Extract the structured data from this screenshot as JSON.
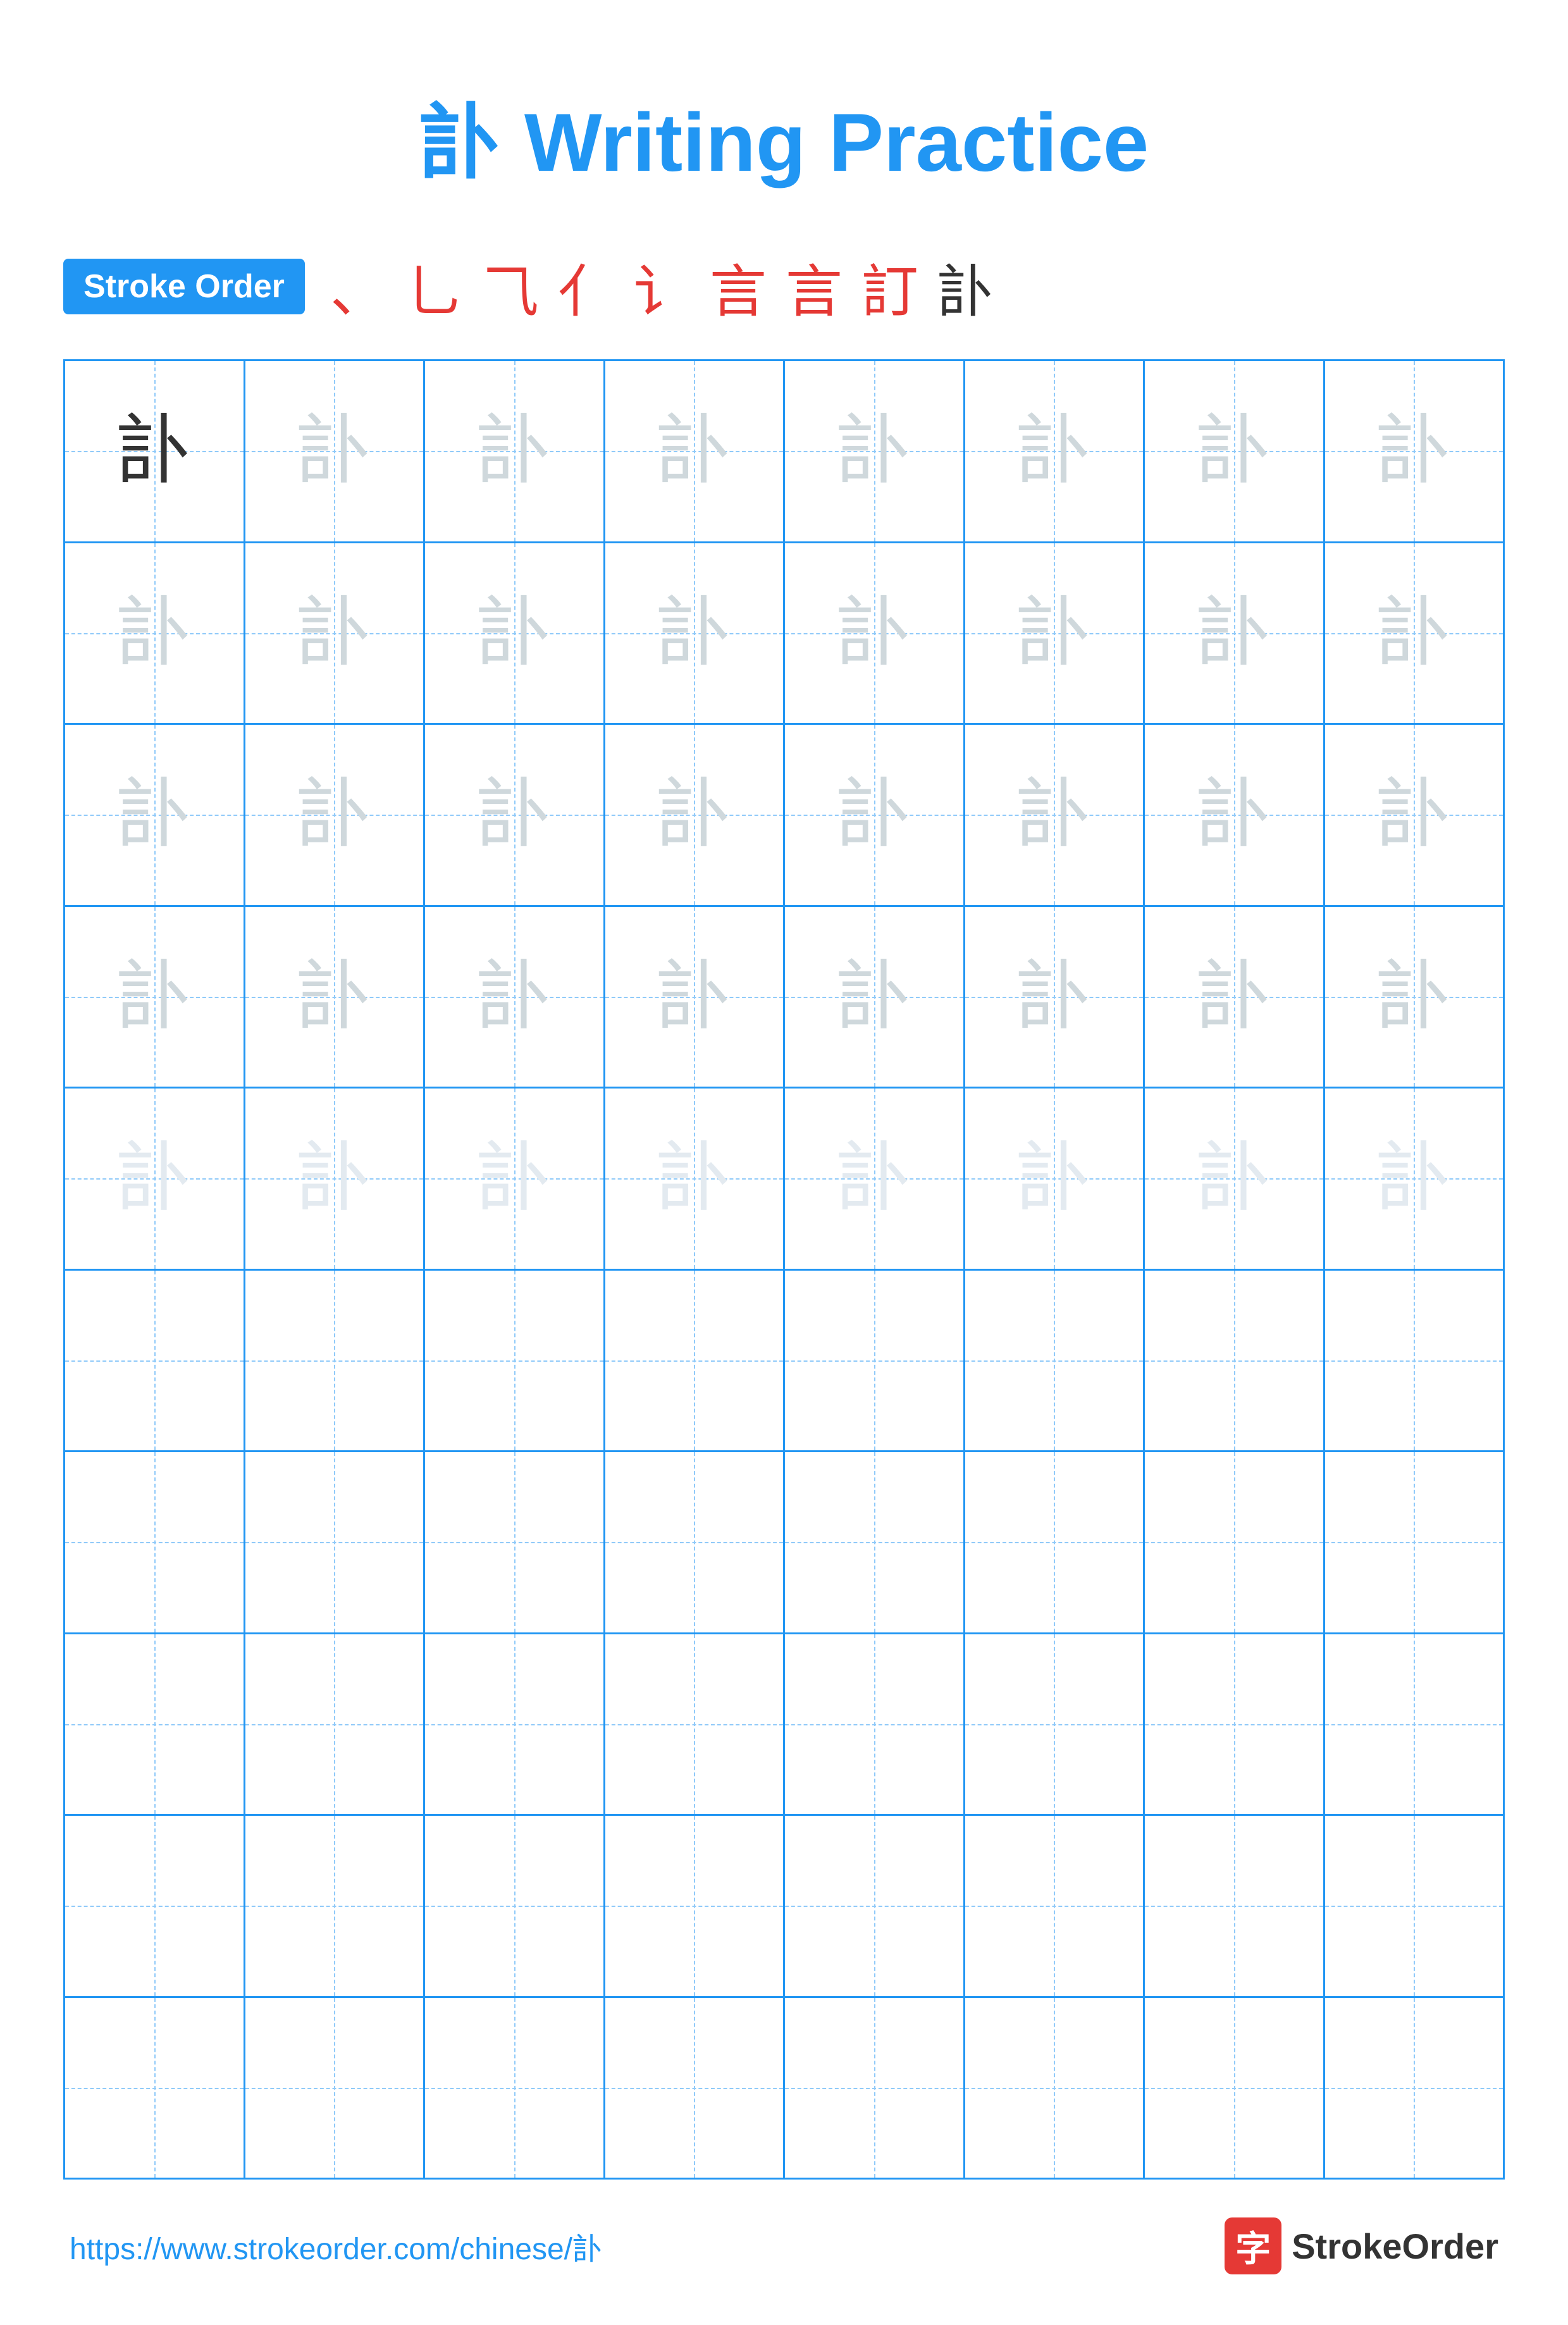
{
  "title": {
    "char": "訃",
    "label": "Writing Practice",
    "full": "訃 Writing Practice"
  },
  "stroke_order": {
    "badge_label": "Stroke Order",
    "chars": [
      "、",
      "⺃",
      "⺄",
      "⺅",
      "讠",
      "言",
      "言",
      "訂",
      "訃"
    ]
  },
  "grid": {
    "rows": 10,
    "cols": 8,
    "practice_char": "訃",
    "practice_rows": 5,
    "empty_rows": 5
  },
  "footer": {
    "url": "https://www.strokeorder.com/chinese/訃",
    "logo_char": "字",
    "logo_text": "StrokeOrder"
  }
}
